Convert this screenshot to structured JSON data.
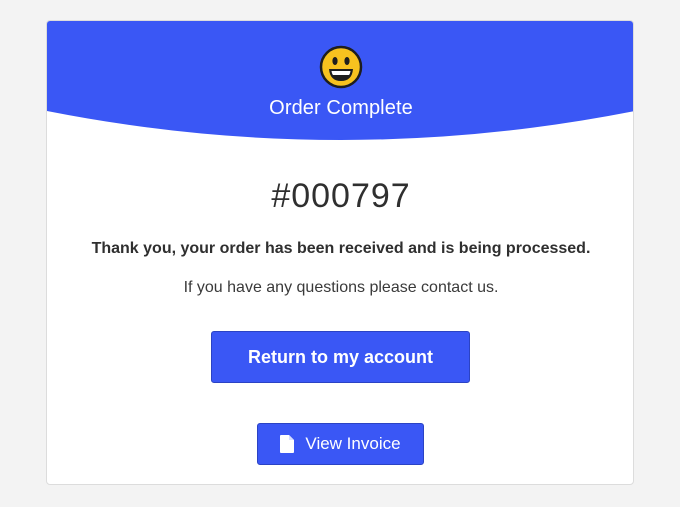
{
  "header": {
    "icon": "grinning-face-icon",
    "title": "Order Complete",
    "color": "#3a57f5"
  },
  "order": {
    "number": "#000797",
    "thanks_message": "Thank you, your order has been received and is being processed.",
    "contact_message": "If you have any questions please contact us."
  },
  "actions": {
    "return_label": "Return to my account",
    "invoice_label": "View Invoice",
    "invoice_icon": "file-icon"
  }
}
